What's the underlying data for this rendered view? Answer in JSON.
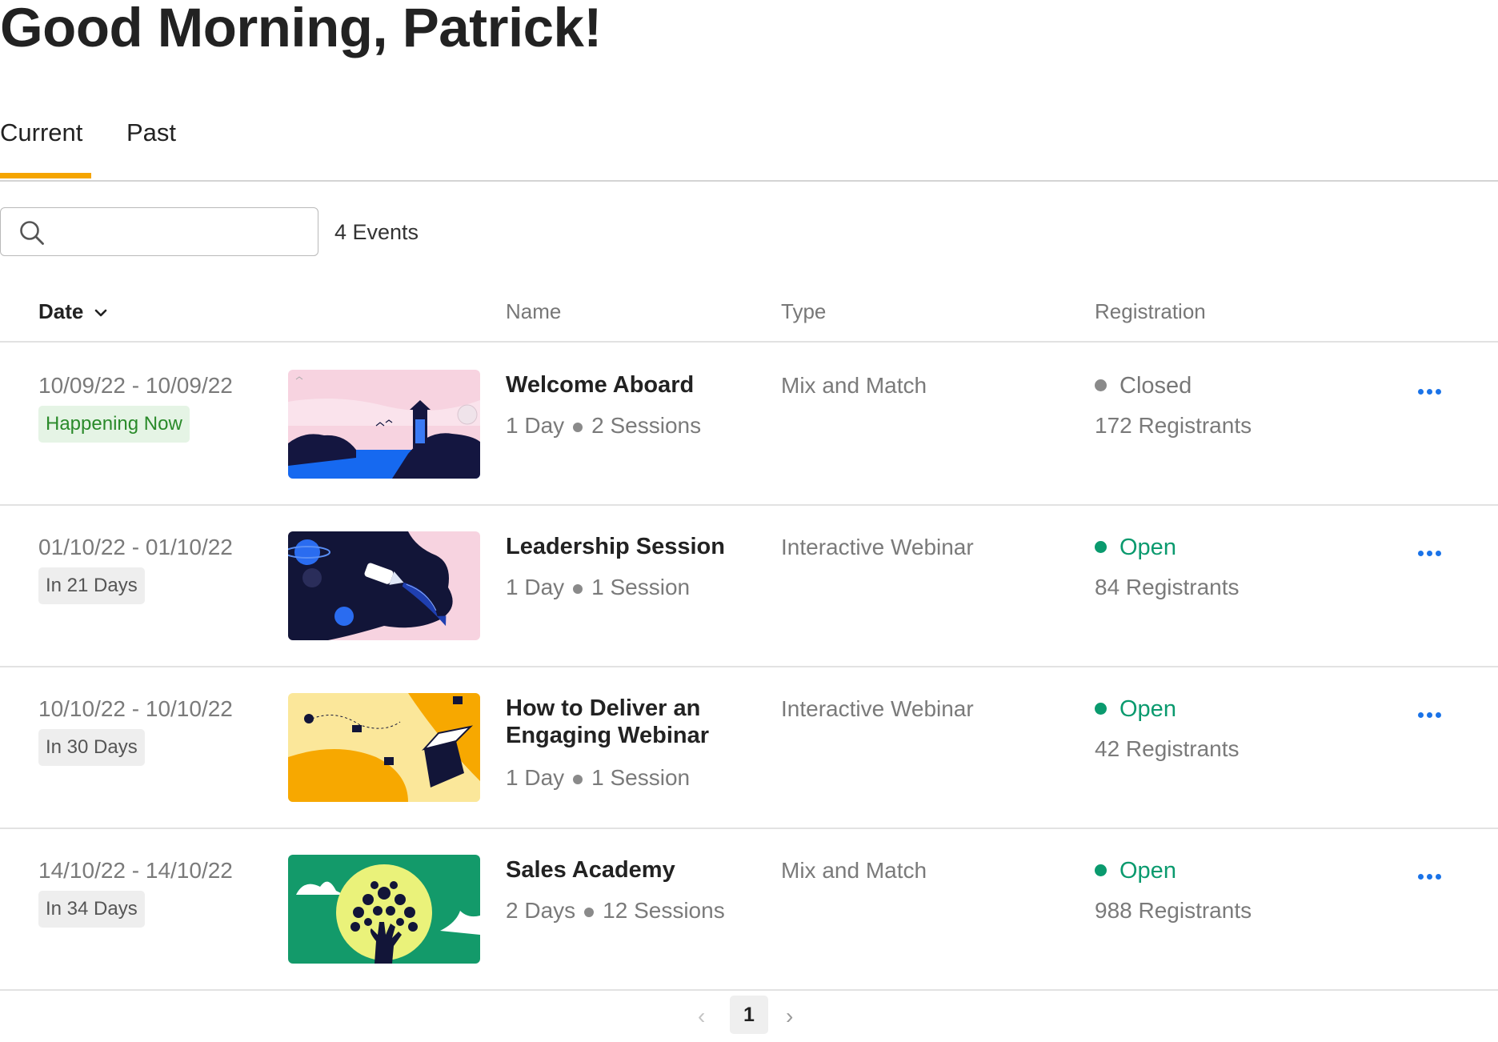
{
  "greeting": "Good Morning, Patrick!",
  "tabs": [
    {
      "label": "Current",
      "active": true
    },
    {
      "label": "Past",
      "active": false
    }
  ],
  "search": {
    "placeholder": "",
    "value": "",
    "icon": "search-icon"
  },
  "event_count": "4 Events",
  "columns": {
    "date": "Date",
    "name": "Name",
    "type": "Type",
    "registration": "Registration"
  },
  "colors": {
    "accent": "#f5a500",
    "open": "#0a9a6e",
    "closed": "#8a8a8a",
    "link": "#1a73e8",
    "live_badge_text": "#2a8a2a"
  },
  "events": [
    {
      "date": "10/09/22 - 10/09/22",
      "badge": "Happening Now",
      "name": "Welcome Aboard",
      "days": "1 Day",
      "sessions": "2 Sessions",
      "type": "Mix and Match",
      "status": "Closed",
      "registrants": "172 Registrants",
      "thumbnail": "lighthouse-illustration"
    },
    {
      "date": "01/10/22 - 01/10/22",
      "badge": "In 21 Days",
      "name": "Leadership Session",
      "days": "1 Day",
      "sessions": "1 Session",
      "type": "Interactive Webinar",
      "status": "Open",
      "registrants": "84 Registrants",
      "thumbnail": "space-rocket-illustration"
    },
    {
      "date": "10/10/22 - 10/10/22",
      "badge": "In 30 Days",
      "name": "How to Deliver an Engaging Webinar",
      "days": "1 Day",
      "sessions": "1 Session",
      "type": "Interactive Webinar",
      "status": "Open",
      "registrants": "42 Registrants",
      "thumbnail": "open-box-illustration"
    },
    {
      "date": "14/10/22 - 14/10/22",
      "badge": "In 34 Days",
      "name": "Sales Academy",
      "days": "2 Days",
      "sessions": "12 Sessions",
      "type": "Mix and Match",
      "status": "Open",
      "registrants": "988 Registrants",
      "thumbnail": "hand-tree-illustration"
    }
  ],
  "pagination": {
    "current_page": "1",
    "prev_icon": "chevron-left-icon",
    "next_icon": "chevron-right-icon"
  }
}
